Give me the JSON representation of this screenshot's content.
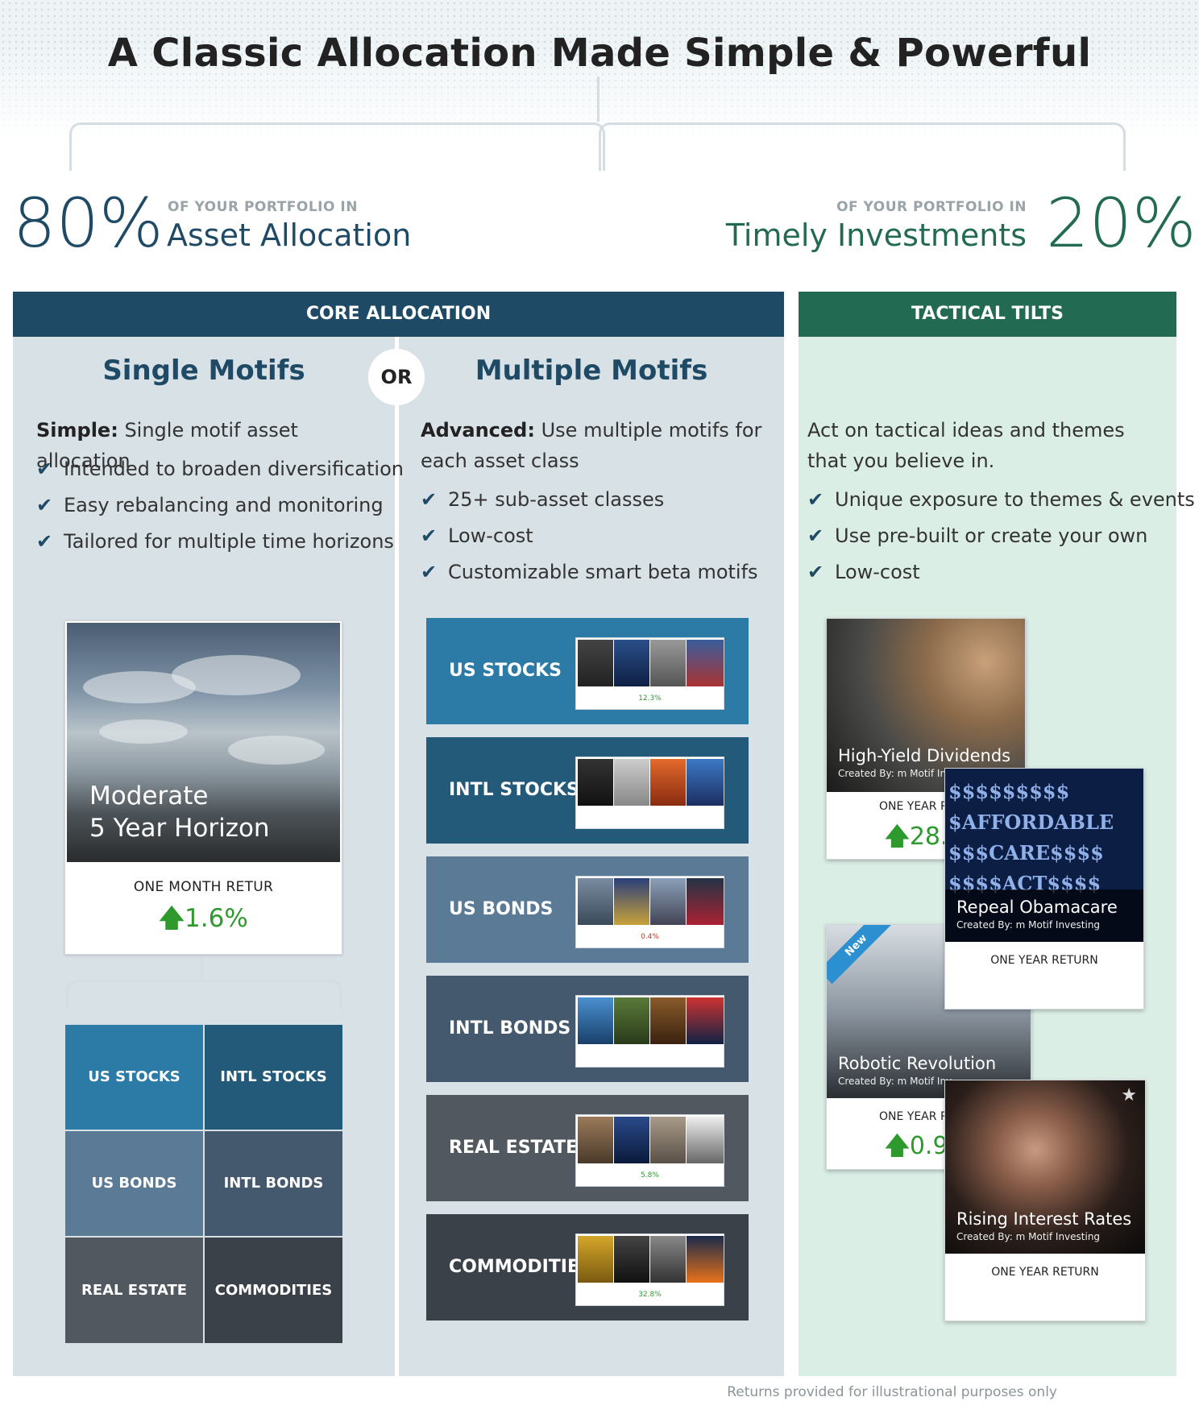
{
  "header": {
    "title": "A Classic Allocation Made Simple & Powerful"
  },
  "left_summary": {
    "percent": "80%",
    "caption": "OF YOUR PORTFOLIO IN",
    "label": "Asset Allocation"
  },
  "right_summary": {
    "percent": "20%",
    "caption": "OF YOUR PORTFOLIO IN",
    "label": "Timely Investments"
  },
  "core": {
    "bar_label": "CORE ALLOCATION",
    "or_label": "OR",
    "single": {
      "title": "Single Motifs",
      "desc_bold": "Simple:",
      "desc_rest": " Single motif asset allocation",
      "checks": [
        "Intended to broaden diversification",
        "Easy rebalancing and monitoring",
        "Tailored for multiple time horizons"
      ],
      "card": {
        "line1": "Moderate",
        "line2": "5 Year Horizon",
        "return_caption": "ONE MONTH RETUR",
        "return_value": "1.6%"
      },
      "grid": [
        "US STOCKS",
        "INTL STOCKS",
        "US BONDS",
        "INTL BONDS",
        "REAL ESTATE",
        "COMMODITIES"
      ]
    },
    "multiple": {
      "title": "Multiple Motifs",
      "desc_bold": "Advanced:",
      "desc_rest": " Use multiple motifs for each asset class",
      "checks": [
        "25+ sub-asset classes",
        "Low-cost",
        "Customizable smart beta motifs"
      ],
      "classes": [
        {
          "label": "US STOCKS",
          "color": "#2c7aa6",
          "mini_return": "12.3%"
        },
        {
          "label": "INTL STOCKS",
          "color": "#245a79",
          "mini_return": ""
        },
        {
          "label": "US BONDS",
          "color": "#5a7a96",
          "mini_return": "0.4%"
        },
        {
          "label": "INTL BONDS",
          "color": "#44596e",
          "mini_return": ""
        },
        {
          "label": "REAL ESTATE",
          "color": "#52585f",
          "mini_return": "5.8%"
        },
        {
          "label": "COMMODITIES",
          "color": "#3b4148",
          "mini_return": "32.8%"
        }
      ]
    }
  },
  "tactical": {
    "bar_label": "TACTICAL TILTS",
    "desc": "Act on tactical ideas and themes that you believe in.",
    "checks": [
      "Unique exposure to themes & events",
      "Use pre-built or create your own",
      "Low-cost"
    ],
    "tiles": [
      {
        "name": "High-Yield Dividends",
        "by": "Created By: m Motif Inv",
        "caption": "ONE YEAR RE",
        "value": "28.4"
      },
      {
        "name": "Repeal Obamacare",
        "by": "Created By: m Motif Investing",
        "caption": "ONE YEAR RETURN",
        "value": "",
        "art": [
          "$$$$$$$$$",
          "$AFFORDABLE",
          "$$$CARE$$$$",
          "$$$$ACT$$$$"
        ]
      },
      {
        "name": "Robotic Revolution",
        "by": "Created By: m Motif Inv",
        "caption": "ONE YEAR RE",
        "value": "0.9",
        "badge": "New"
      },
      {
        "name": "Rising Interest Rates",
        "by": "Created By: m Motif Investing",
        "caption": "ONE YEAR RETURN",
        "value": ""
      }
    ]
  },
  "footnote": "Returns provided for illustrational purposes only",
  "colors": {
    "core_bar": "#1f4a66",
    "tactical_bar": "#236a52",
    "core_bg": "#d8e1e6",
    "tactical_bg": "#dbeee6",
    "positive": "#2e9a2e"
  }
}
